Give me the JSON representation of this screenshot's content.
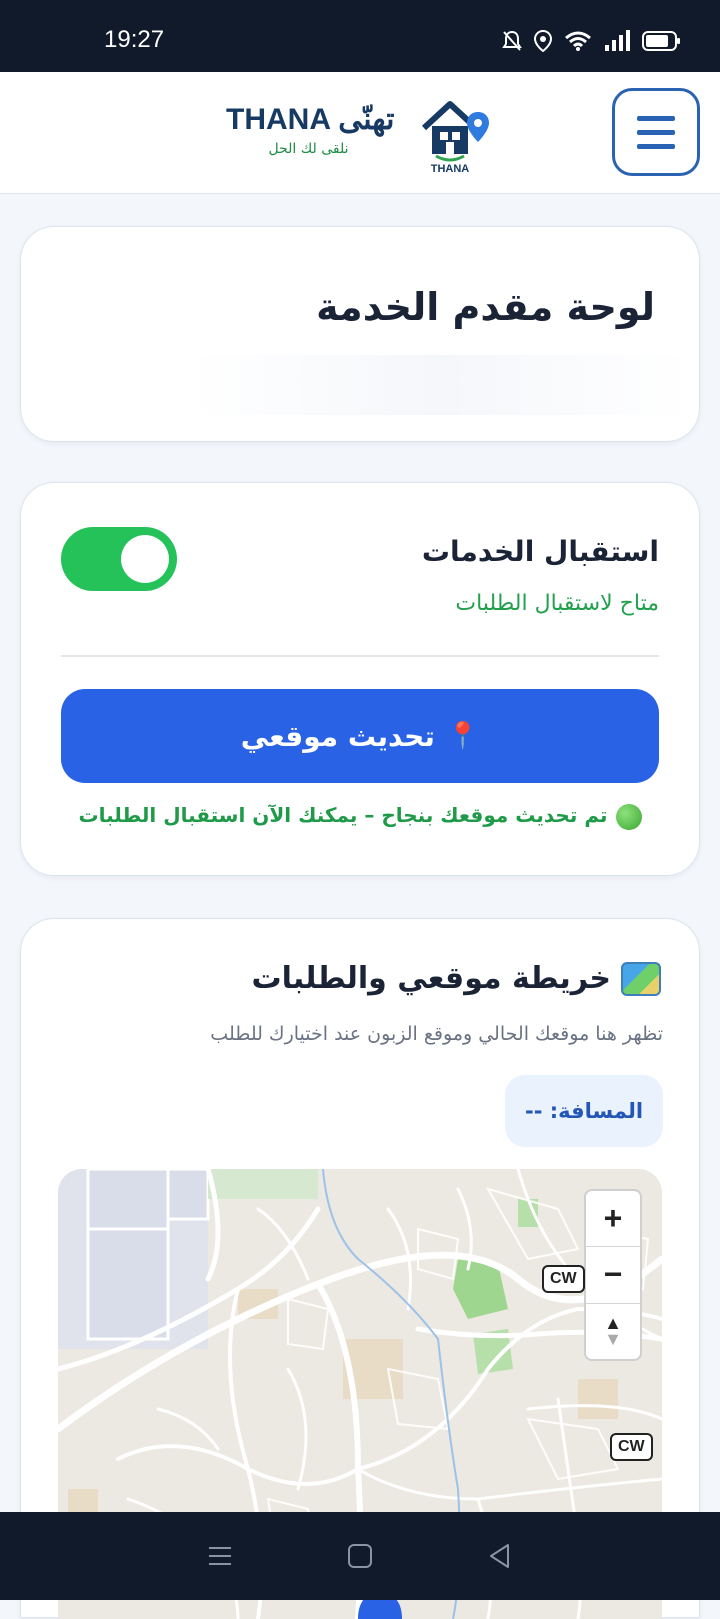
{
  "status_bar": {
    "time": "19:27"
  },
  "header": {
    "brand_title": "THANA تهنّى",
    "brand_subtitle": "نلقى لك الحل",
    "logo_text": "THANA"
  },
  "dashboard": {
    "title": "لوحة مقدم الخدمة"
  },
  "service": {
    "title": "استقبال الخدمات",
    "status": "متاح لاستقبال الطلبات",
    "toggle_on": true,
    "update_button": "تحديث موقعي",
    "success_message": "تم تحديث موقعك بنجاح – يمكنك الآن استقبال الطلبات"
  },
  "map_section": {
    "title": "خريطة موقعي والطلبات",
    "subtitle": "تظهر هنا موقعك الحالي وموقع الزبون عند اختيارك للطلب",
    "distance_label": "المسافة: --",
    "zoom_in": "+",
    "zoom_out": "−",
    "road_label_1": "CW",
    "road_label_2": "CW"
  },
  "colors": {
    "accent": "#2a62e6",
    "success": "#22a04e",
    "brand": "#163a63"
  }
}
